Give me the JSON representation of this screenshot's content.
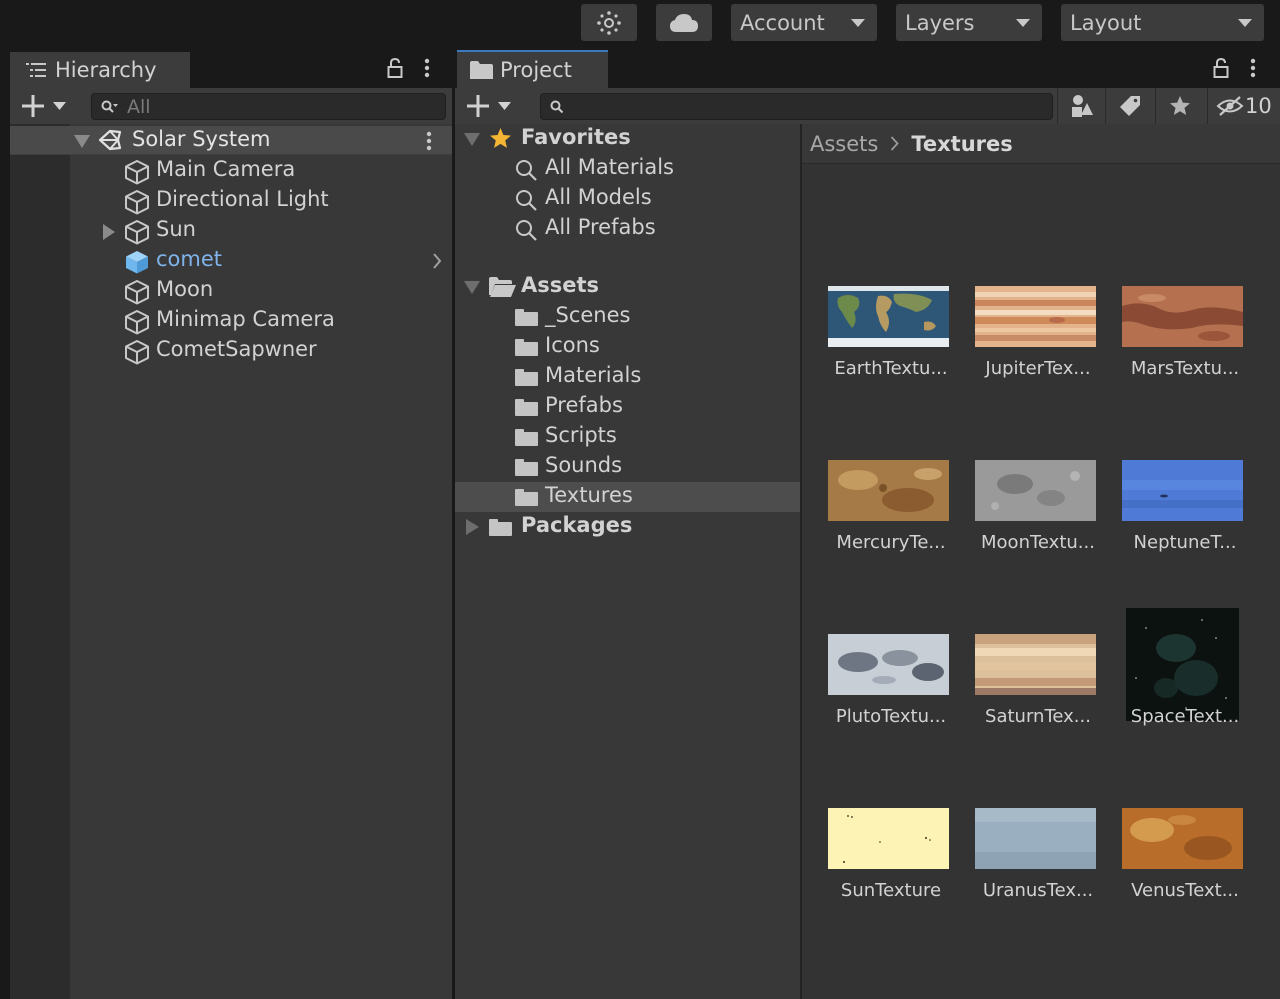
{
  "toolbar": {
    "settings_icon": "gear-sun-icon",
    "cloud_icon": "cloud-icon",
    "account_label": "Account",
    "layers_label": "Layers",
    "layout_label": "Layout"
  },
  "hierarchy": {
    "tab_label": "Hierarchy",
    "search_placeholder": "All",
    "scene_name": "Solar System",
    "items": [
      {
        "label": "Main Camera"
      },
      {
        "label": "Directional Light"
      },
      {
        "label": "Sun"
      },
      {
        "label": "comet"
      },
      {
        "label": "Moon"
      },
      {
        "label": "Minimap Camera"
      },
      {
        "label": "CometSapwner"
      }
    ]
  },
  "project": {
    "tab_label": "Project",
    "search_placeholder": "",
    "hidden_count": "10",
    "favorites": {
      "label": "Favorites",
      "items": [
        "All Materials",
        "All Models",
        "All Prefabs"
      ]
    },
    "assets": {
      "label": "Assets",
      "folders": [
        "_Scenes",
        "Icons",
        "Materials",
        "Prefabs",
        "Scripts",
        "Sounds",
        "Textures"
      ]
    },
    "packages_label": "Packages",
    "breadcrumb": {
      "root": "Assets",
      "current": "Textures"
    },
    "textures": [
      {
        "name": "EarthTextu...",
        "color": "#2f5a7a"
      },
      {
        "name": "JupiterTex...",
        "color": "#d79a6c"
      },
      {
        "name": "MarsTextu...",
        "color": "#b0694c"
      },
      {
        "name": "MercuryTe...",
        "color": "#a4743f"
      },
      {
        "name": "MoonTextu...",
        "color": "#8c8c8c"
      },
      {
        "name": "NeptuneT...",
        "color": "#4d78d4"
      },
      {
        "name": "PlutoTextu...",
        "color": "#9ea7b4"
      },
      {
        "name": "SaturnTex...",
        "color": "#d6b48e"
      },
      {
        "name": "SpaceText...",
        "color": "#0c1410"
      },
      {
        "name": "SunTexture",
        "color": "#fdf3b4"
      },
      {
        "name": "UranusTex...",
        "color": "#99acbc"
      },
      {
        "name": "VenusText...",
        "color": "#b86d2b"
      }
    ]
  },
  "colors": {
    "selected_text": "#7fb3ea",
    "selected_cube": "#6fb7ef",
    "favorite_star": "#f3b533",
    "tab_highlight": "#3a79bb"
  }
}
